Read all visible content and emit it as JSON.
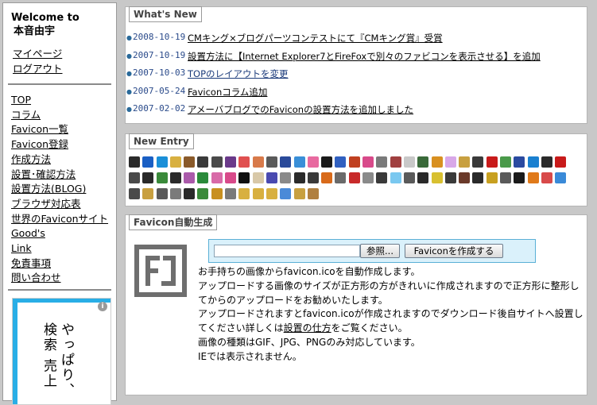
{
  "sidebar": {
    "welcome_label": "Welcome to",
    "user_name": "本音由宇",
    "user_links": [
      "マイページ",
      "ログアウト"
    ],
    "nav": [
      "TOP",
      "コラム",
      "Favicon一覧",
      "Favicon登録",
      "作成方法",
      "設置･確認方法",
      "設置方法(BLOG)",
      "ブラウザ対応表",
      "世界のFaviconサイト",
      "Good's",
      "Link",
      "免責事項",
      "問い合わせ"
    ],
    "ad": {
      "text": "やっぱり、検索 売上",
      "info_icon": "i"
    }
  },
  "whats_new": {
    "title": "What's New",
    "items": [
      {
        "date": "2008-10-19",
        "title": "CMキング×ブログパーツコンテストにて『CMキング賞』受賞"
      },
      {
        "date": "2007-10-19",
        "title": "設置方法に【Internet Explorer7とFireFoxで別々のファビコンを表示させる】を追加"
      },
      {
        "date": "2007-10-03",
        "title": "TOPのレイアウトを変更"
      },
      {
        "date": "2007-05-24",
        "title": "Faviconコラム追加"
      },
      {
        "date": "2007-02-02",
        "title": "アメーバブログでのFaviconの設置方法を追加しました"
      }
    ]
  },
  "new_entry": {
    "title": "New Entry",
    "icon_colors": [
      "#2a2a2a",
      "#1a5fc4",
      "#1a8fd8",
      "#d8b040",
      "#8a5a2a",
      "#3a3a3a",
      "#4a4a4a",
      "#6a3a8a",
      "#e05050",
      "#d87a4a",
      "#5a5a5a",
      "#2a4a9a",
      "#3a8fd8",
      "#e86aa0",
      "#1a1a1a",
      "#3060c0",
      "#c04020",
      "#d84a8a",
      "#7a7a7a",
      "#a04040",
      "#c8c8c8",
      "#3a6a3a",
      "#d89020",
      "#d8a8e8",
      "#c8a040",
      "#3a3a3a",
      "#c81a1a",
      "#4a9a4a",
      "#2a4aa0",
      "#1a80d0",
      "#2a2a2a",
      "#c81a1a",
      "#4a4a4a",
      "#2a2a2a",
      "#3a8a3a",
      "#2a2a2a",
      "#aa5aaa",
      "#2a8a3a",
      "#d86aa8",
      "#d84a8a",
      "#111111",
      "#d8c8a8",
      "#4a4ab0",
      "#8a8a8a",
      "#2a2a2a",
      "#3a3a3a",
      "#d86a1a",
      "#6a6a6a",
      "#c82a2a",
      "#8a8a8a",
      "#3a3a3a",
      "#7ac8f0",
      "#5a5a5a",
      "#2a2a2a",
      "#d8c030",
      "#3a3a3a",
      "#6a3a2a",
      "#2a2a2a",
      "#c8a020",
      "#5a5a5a",
      "#1a1a1a",
      "#e07a1a",
      "#d84a4a",
      "#3a8ad8",
      "#4a4a4a",
      "#c8a040",
      "#5a5a5a",
      "#7a7a7a",
      "#2a2a2a",
      "#3a8a3a",
      "#c89020",
      "#7a7a7a",
      "#d8b040",
      "#d8b040",
      "#d8b040",
      "#4a8ad8",
      "#c8a040",
      "#b08040"
    ]
  },
  "favicon_gen": {
    "title": "Favicon自動生成",
    "browse_button": "参照...",
    "create_button": "Faviconを作成する",
    "file_value": "",
    "desc_lines": [
      "お手持ちの画像からfavicon.icoを自動作成します。",
      "アップロードする画像のサイズが正方形の方がきれいに作成されますので正方形に整形してからのアップロードをお勧めいたします。",
      "アップロードされますとfavicon.icoが作成されますのでダウンロード後自サイトへ設置してください詳しくは",
      "設置の仕方",
      "をご覧ください。",
      "画像の種類はGIF、JPG、PNGのみ対応しています。",
      "IEでは表示されません。"
    ]
  }
}
